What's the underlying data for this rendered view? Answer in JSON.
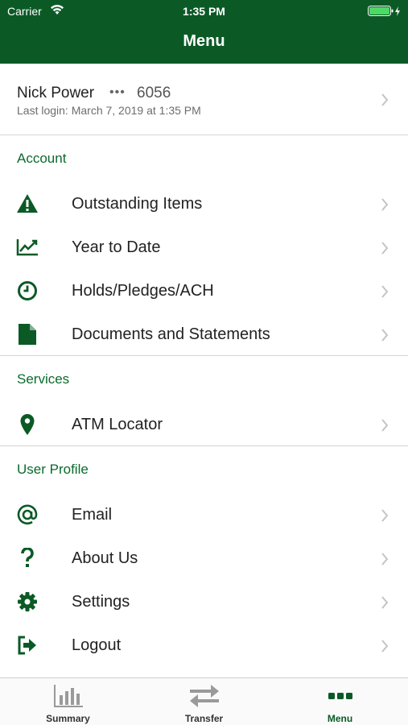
{
  "status_bar": {
    "carrier": "Carrier",
    "time": "1:35 PM"
  },
  "header": {
    "title": "Menu"
  },
  "user": {
    "name": "Nick Power",
    "masked": "•••",
    "account_suffix": "6056",
    "last_login": "Last login: March 7, 2019 at 1:35 PM"
  },
  "sections": {
    "account": {
      "title": "Account",
      "items": [
        {
          "label": "Outstanding Items",
          "icon": "warning-icon"
        },
        {
          "label": "Year to Date",
          "icon": "line-chart-icon"
        },
        {
          "label": "Holds/Pledges/ACH",
          "icon": "clock-icon"
        },
        {
          "label": "Documents and Statements",
          "icon": "document-icon"
        }
      ]
    },
    "services": {
      "title": "Services",
      "items": [
        {
          "label": "ATM Locator",
          "icon": "map-pin-icon"
        }
      ]
    },
    "user_profile": {
      "title": "User Profile",
      "items": [
        {
          "label": "Email",
          "icon": "at-icon"
        },
        {
          "label": "About Us",
          "icon": "question-icon"
        },
        {
          "label": "Settings",
          "icon": "gear-icon"
        },
        {
          "label": "Logout",
          "icon": "logout-icon"
        }
      ]
    }
  },
  "tabbar": {
    "tabs": [
      {
        "label": "Summary",
        "icon": "bar-chart-icon",
        "active": false
      },
      {
        "label": "Transfer",
        "icon": "transfer-arrows-icon",
        "active": false
      },
      {
        "label": "Menu",
        "icon": "more-dots-icon",
        "active": true
      }
    ]
  },
  "colors": {
    "brand": "#0b5a26",
    "section_text": "#0b6a2c"
  }
}
